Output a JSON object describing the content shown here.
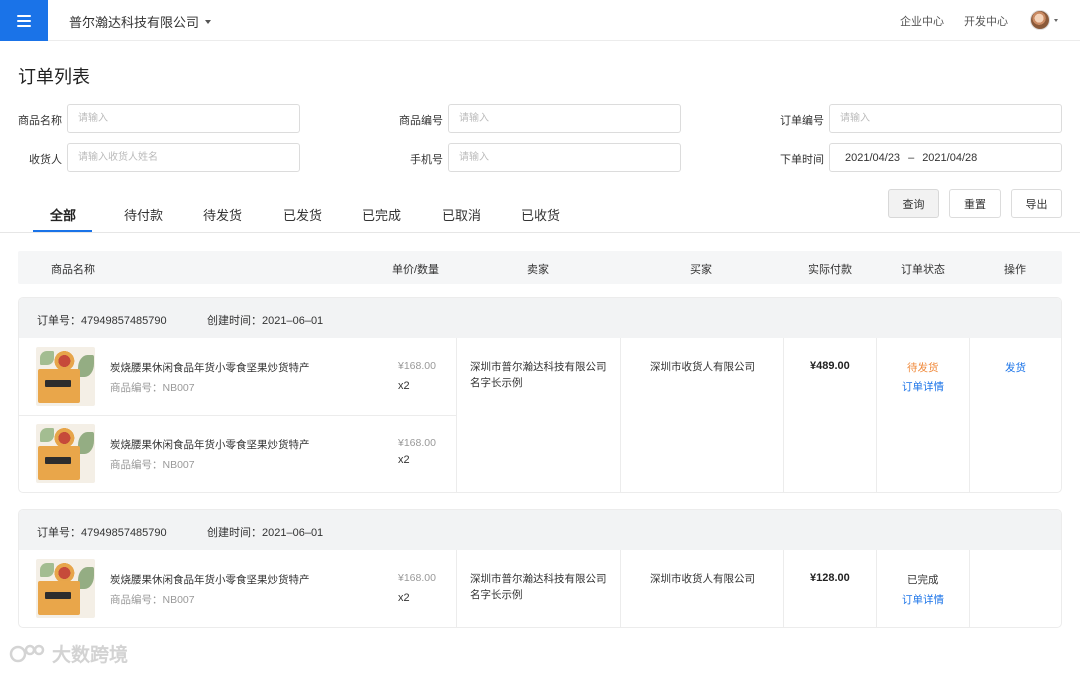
{
  "topbar": {
    "company": "普尔瀚达科技有限公司",
    "nav": [
      "企业中心",
      "开发中心"
    ]
  },
  "page_title": "订单列表",
  "filters": {
    "product_name_label": "商品名称",
    "product_code_label": "商品编号",
    "order_no_label": "订单编号",
    "receiver_label": "收货人",
    "phone_label": "手机号",
    "order_time_label": "下单时间",
    "placeholder": "请输入",
    "receiver_placeholder": "请输入收货人姓名",
    "date_start": "2021/04/23",
    "date_sep": "–",
    "date_end": "2021/04/28"
  },
  "tabs": [
    "全部",
    "待付款",
    "待发货",
    "已发货",
    "已完成",
    "已取消",
    "已收货"
  ],
  "actions": {
    "query": "查询",
    "reset": "重置",
    "export": "导出"
  },
  "table_header": {
    "product": "商品名称",
    "price_qty": "单价/数量",
    "seller": "卖家",
    "buyer": "买家",
    "paid": "实际付款",
    "status": "订单状态",
    "operation": "操作"
  },
  "orders": [
    {
      "order_no": "订单号：47949857485790",
      "created": "创建时间：2021–06–01",
      "items": [
        {
          "name": "炭烧腰果休闲食品年货小零食坚果炒货特产",
          "code": "商品编号：NB007",
          "price": "¥168.00",
          "qty": "x2"
        },
        {
          "name": "炭烧腰果休闲食品年货小零食坚果炒货特产",
          "code": "商品编号：NB007",
          "price": "¥168.00",
          "qty": "x2"
        }
      ],
      "seller_line1": "深圳市普尔瀚达科技有限公司",
      "seller_line2": "名字长示例",
      "buyer": "深圳市收货人有限公司",
      "paid": "¥489.00",
      "status": "待发货",
      "detail_link": "订单详情",
      "operation": "发货"
    },
    {
      "order_no": "订单号：47949857485790",
      "created": "创建时间：2021–06–01",
      "items": [
        {
          "name": "炭烧腰果休闲食品年货小零食坚果炒货特产",
          "code": "商品编号：NB007",
          "price": "¥168.00",
          "qty": "x2"
        }
      ],
      "seller_line1": "深圳市普尔瀚达科技有限公司",
      "seller_line2": "名字长示例",
      "buyer": "深圳市收货人有限公司",
      "paid": "¥128.00",
      "status": "已完成",
      "detail_link": "订单详情"
    }
  ],
  "watermark": "大数跨境",
  "colors": {
    "primary": "#1a73e8",
    "pending": "#f08a3c"
  }
}
